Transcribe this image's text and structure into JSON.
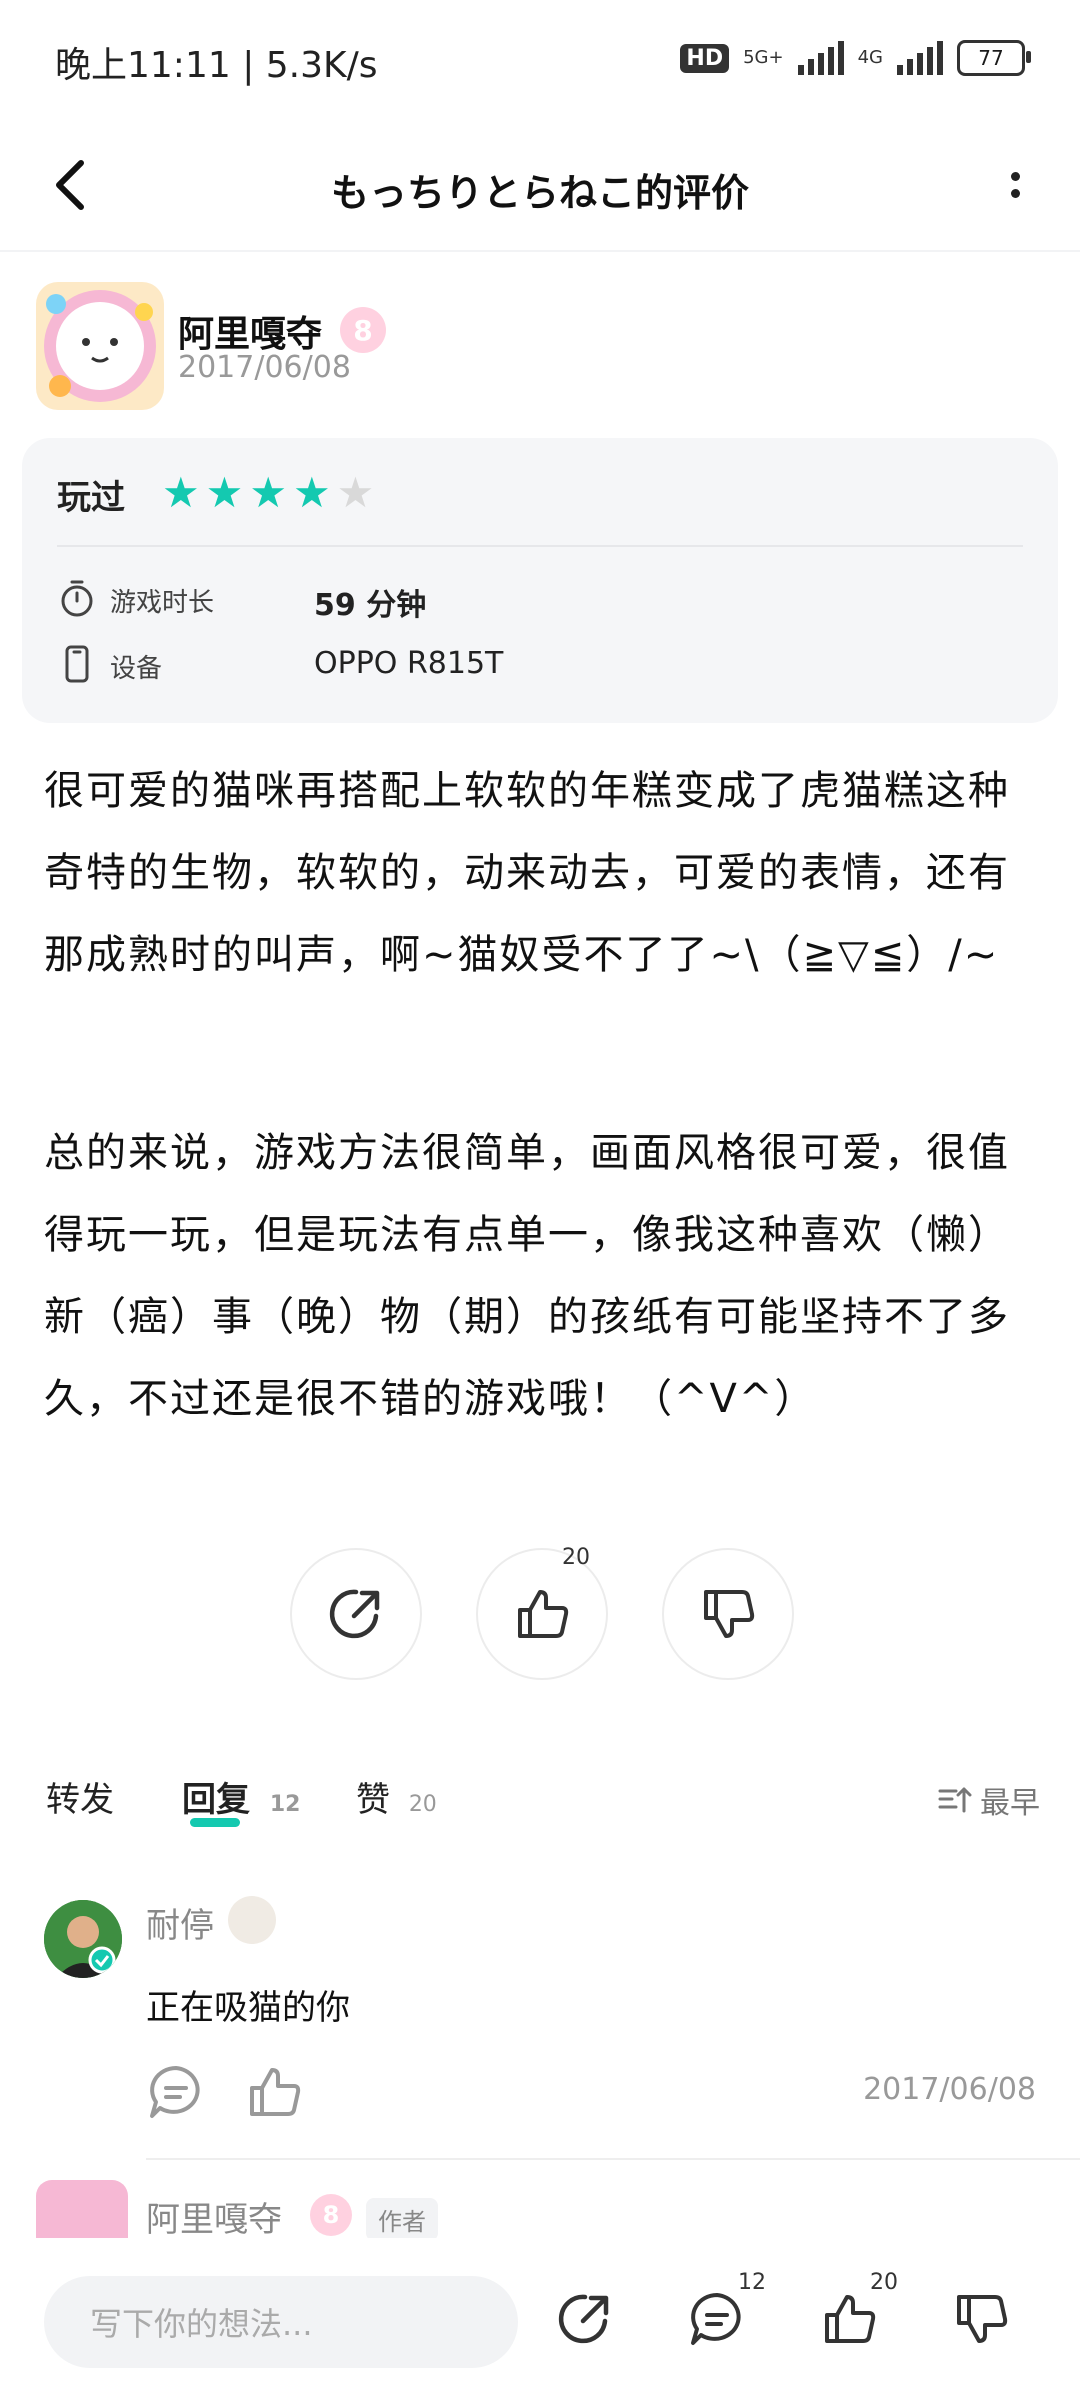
{
  "status_bar": {
    "time": "晚上11:11 | 5.3K/s",
    "hd": "HD",
    "network_a": "5G+",
    "network_b": "4G",
    "battery": "77"
  },
  "header": {
    "title": "もっちりとらねこ的评价"
  },
  "review": {
    "author": "阿里嘎夺",
    "level": "8",
    "date": "2017/06/08",
    "played_label": "玩过",
    "rating": 4,
    "rating_max": 5,
    "colors": {
      "star_on": "#14c9b0",
      "star_off": "#d9d9d9",
      "accent": "#14c9b0"
    },
    "play_time_label": "游戏时长",
    "play_time_value": "59 分钟",
    "device_label": "设备",
    "device_value": "OPPO R815T",
    "paragraph1": "很可爱的猫咪再搭配上软软的年糕变成了虎猫糕这种奇特的生物，软软的，动来动去，可爱的表情，还有那成熟时的叫声，啊~猫奴受不了了~\\（≧▽≦）/~",
    "paragraph2": "总的来说，游戏方法很简单，画面风格很可爱，很值得玩一玩，但是玩法有点单一，像我这种喜欢（懒）新（癌）事（晚）物（期）的孩纸有可能坚持不了多久，不过还是很不错的游戏哦！（^V^）",
    "like_count": "20"
  },
  "tabs": {
    "share": "转发",
    "reply": "回复",
    "reply_count": "12",
    "like": "赞",
    "like_count": "20",
    "sort": "最早"
  },
  "comments": [
    {
      "name": "耐停",
      "text": "正在吸猫的你",
      "date": "2017/06/08"
    },
    {
      "name": "阿里嘎夺",
      "level": "8",
      "tag": "作者"
    }
  ],
  "bottom_bar": {
    "placeholder": "写下你的想法...",
    "reply_count": "12",
    "like_count": "20"
  }
}
